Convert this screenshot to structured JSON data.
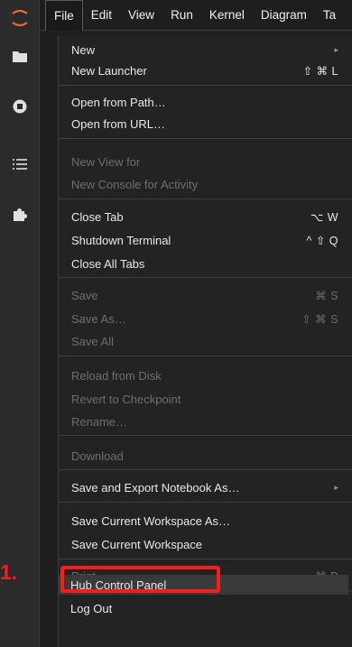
{
  "menubar": {
    "items": [
      "File",
      "Edit",
      "View",
      "Run",
      "Kernel",
      "Diagram",
      "Ta"
    ],
    "active": "File"
  },
  "activity_bar": {
    "icons": [
      "jupyter-logo-icon",
      "folder-icon",
      "running-stop-icon",
      "list-icon",
      "puzzle-extension-icon"
    ]
  },
  "file_menu": {
    "new": "New",
    "new_launcher": "New Launcher",
    "new_launcher_sc": "⇧ ⌘ L",
    "open_from_path": "Open from Path…",
    "open_from_url": "Open from URL…",
    "new_view_for": "New View for",
    "new_console_for_activity": "New Console for Activity",
    "close_tab": "Close Tab",
    "close_tab_sc": "⌥ W",
    "shutdown_terminal": "Shutdown Terminal",
    "shutdown_terminal_sc": "^ ⇧ Q",
    "close_all_tabs": "Close All Tabs",
    "save": "Save",
    "save_sc": "⌘ S",
    "save_as": "Save As…",
    "save_as_sc": "⇧ ⌘ S",
    "save_all": "Save All",
    "reload_from_disk": "Reload from Disk",
    "revert_to_checkpoint": "Revert to Checkpoint",
    "rename": "Rename…",
    "download": "Download",
    "save_export": "Save and Export Notebook As…",
    "save_workspace_as": "Save Current Workspace As…",
    "save_workspace": "Save Current Workspace",
    "print": "Print…",
    "print_sc": "⌘ P",
    "hub_control_panel": "Hub Control Panel",
    "log_out": "Log Out"
  },
  "annotation": {
    "step_label": "1.",
    "color": "#ff1a1a"
  }
}
